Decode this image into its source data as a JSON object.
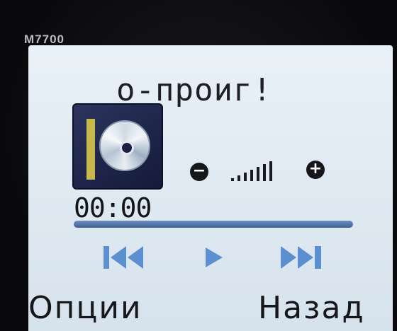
{
  "device": {
    "brand": "M7700"
  },
  "player": {
    "title": "о-проиг!",
    "time": "00:00",
    "progress": 0,
    "volume_level": 7,
    "volume_max": 7
  },
  "volume": {
    "minus_symbol": "−",
    "plus_symbol": "+"
  },
  "softkeys": {
    "left": "Опции",
    "right": "Назад"
  },
  "colors": {
    "screen": "#e3ecf4",
    "accent": "#4f77b8",
    "control": "#5b8fd0",
    "text": "#16171b"
  }
}
